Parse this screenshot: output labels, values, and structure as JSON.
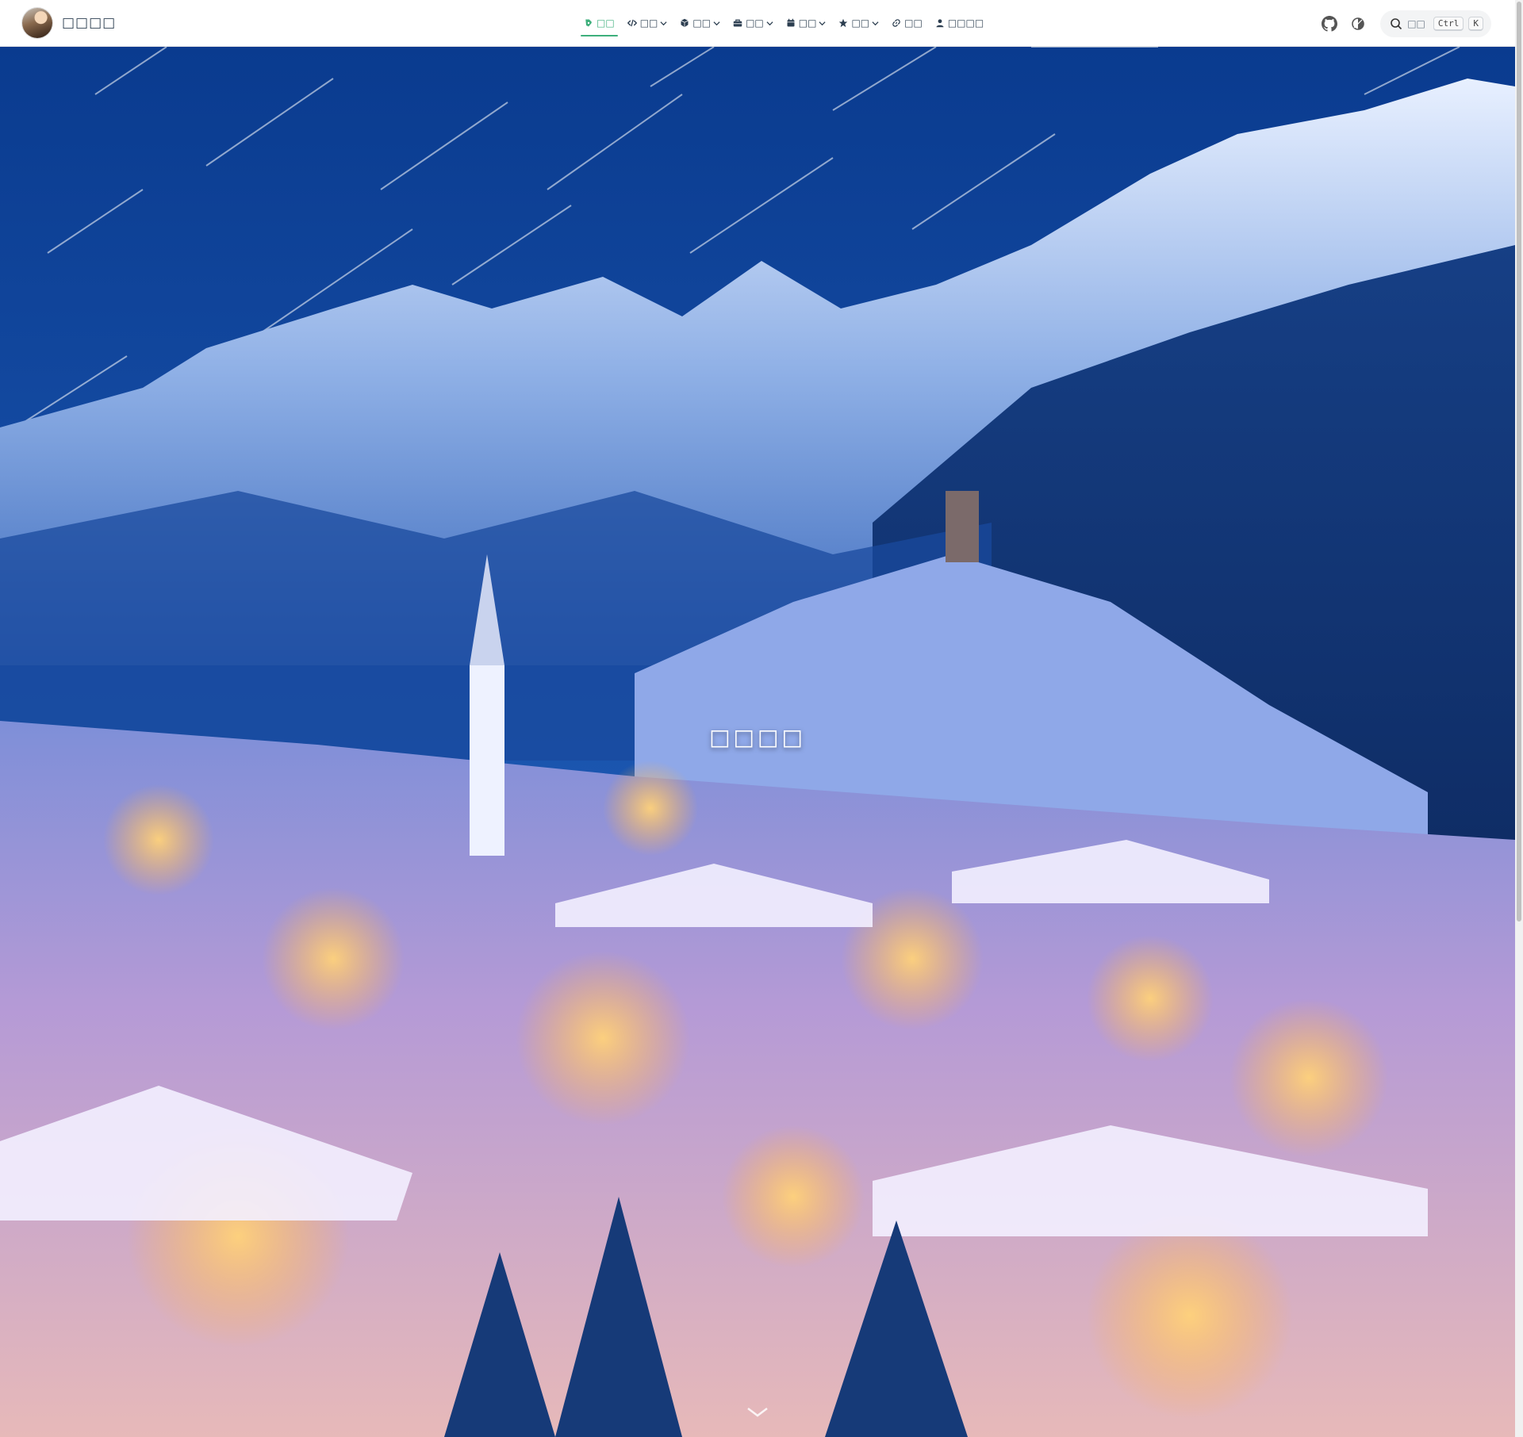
{
  "site": {
    "title": "□□□□"
  },
  "nav": {
    "items": [
      {
        "label": "□□",
        "icon": "blog-icon",
        "dropdown": false,
        "active": true
      },
      {
        "label": "□□",
        "icon": "code-icon",
        "dropdown": true,
        "active": false
      },
      {
        "label": "□□",
        "icon": "cube-icon",
        "dropdown": true,
        "active": false
      },
      {
        "label": "□□",
        "icon": "toolbox-icon",
        "dropdown": true,
        "active": false
      },
      {
        "label": "□□",
        "icon": "calendar-icon",
        "dropdown": true,
        "active": false
      },
      {
        "label": "□□",
        "icon": "star-icon",
        "dropdown": true,
        "active": false
      },
      {
        "label": "□□",
        "icon": "link-icon",
        "dropdown": false,
        "active": false
      },
      {
        "label": "□□□□",
        "icon": "user-icon",
        "dropdown": false,
        "active": false
      }
    ]
  },
  "search": {
    "placeholder": "□□",
    "shortcut": [
      "Ctrl",
      "K"
    ]
  },
  "hero": {
    "title": "□□□□"
  },
  "colors": {
    "accent": "#3eaf7c",
    "text": "#2c3e50"
  }
}
